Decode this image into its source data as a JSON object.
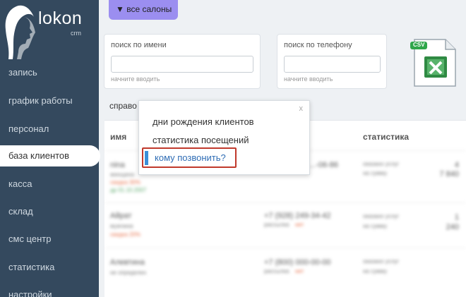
{
  "logo": {
    "name": "lokon",
    "sub": "crm"
  },
  "sidebar": {
    "items": [
      {
        "label": "запись"
      },
      {
        "label": "график работы"
      },
      {
        "label": "персонал"
      },
      {
        "label": "база клиентов",
        "active": true
      },
      {
        "label": "касса"
      },
      {
        "label": "склад"
      },
      {
        "label": "смс центр"
      },
      {
        "label": "статистика"
      },
      {
        "label": "настройки"
      }
    ]
  },
  "filter": {
    "salon_label": "▼ все салоны"
  },
  "search_name": {
    "label": "поиск по имени",
    "value": "",
    "hint": "начните вводить"
  },
  "search_phone": {
    "label": "поиск по телефону",
    "value": "",
    "hint": "начните вводить"
  },
  "export": {
    "badge": "CSV"
  },
  "reports": {
    "label": "справо"
  },
  "popup": {
    "close": "x",
    "items": [
      {
        "label": "дни рождения клиентов"
      },
      {
        "label": "статистика посещений"
      },
      {
        "label": "кому позвонить?",
        "selected": true
      }
    ]
  },
  "table": {
    "headers": {
      "name": "имя",
      "stats": "статистика"
    },
    "rows": [
      {
        "name": "nina",
        "line2": "женщина",
        "line3": "скидка 30%",
        "line4": "др 01.10.2007",
        "phone": "...-06-86",
        "stats1": "оказано услуг",
        "stats2": "на сумму",
        "n1": "4",
        "n2": "7 840"
      },
      {
        "name": "Айрат",
        "line2": "мужчина",
        "line3": "скидка 20%",
        "phone": "+7 (928) 249-34-42",
        "phone_note": "рассылка",
        "phone_flag": "нет",
        "stats1": "оказано услуг",
        "stats2": "на сумму",
        "n1": "1",
        "n2": "240"
      },
      {
        "name": "Алевтина",
        "line2": "не определен",
        "phone": "+7 (800) 000-00-00",
        "phone_note": "рассылка",
        "phone_flag": "нет",
        "stats1": "оказано услуг",
        "stats2": "на сумму"
      }
    ]
  }
}
